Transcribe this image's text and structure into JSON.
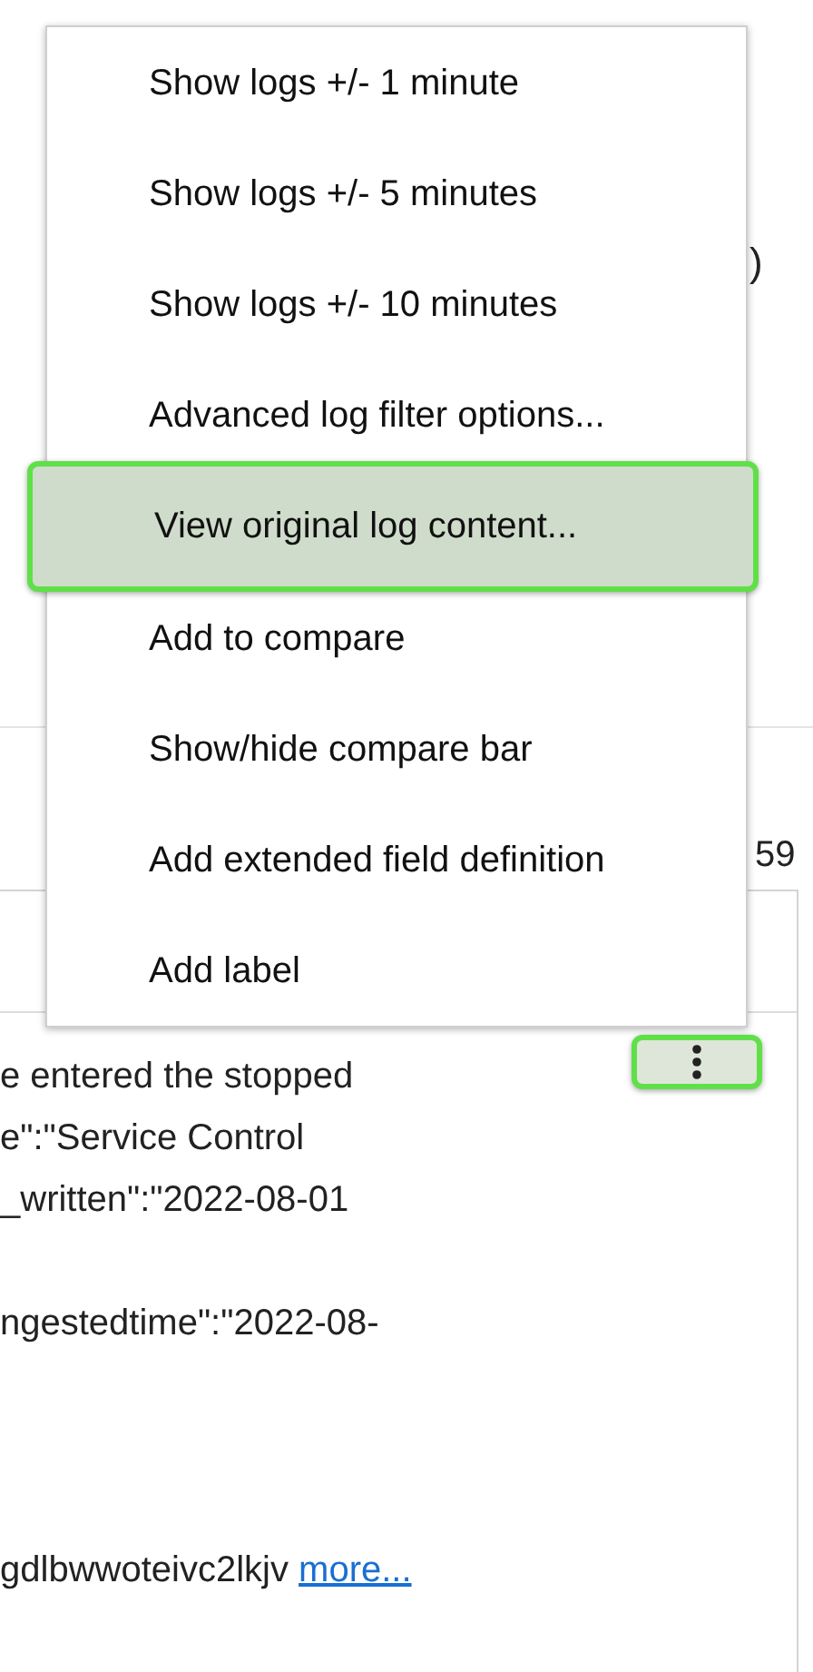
{
  "background": {
    "fragment": ")",
    "count": "59",
    "log_blocks": [
      {
        "lines": [
          "e entered the stopped",
          "e\":\"Service Control",
          "_written\":\"2022-08-01"
        ]
      },
      {
        "lines": [
          "ngestedtime\":\"2022-08-"
        ]
      },
      {
        "lines": [
          "gdlbwwoteivc2lkjv"
        ],
        "link": "more..."
      }
    ],
    "menu_button": {
      "selected": true
    }
  },
  "menu": {
    "items": [
      {
        "label": "Show logs +/- 1 minute",
        "selected": false
      },
      {
        "label": "Show logs +/- 5 minutes",
        "selected": false
      },
      {
        "label": "Show logs +/- 10 minutes",
        "selected": false
      },
      {
        "label": "Advanced log filter options...",
        "selected": false
      },
      {
        "label": "View original log content...",
        "selected": true
      },
      {
        "label": "Add to compare",
        "selected": false
      },
      {
        "label": "Show/hide compare bar",
        "selected": false
      },
      {
        "label": "Add extended field definition",
        "selected": false
      },
      {
        "label": "Add label",
        "selected": false
      }
    ]
  }
}
